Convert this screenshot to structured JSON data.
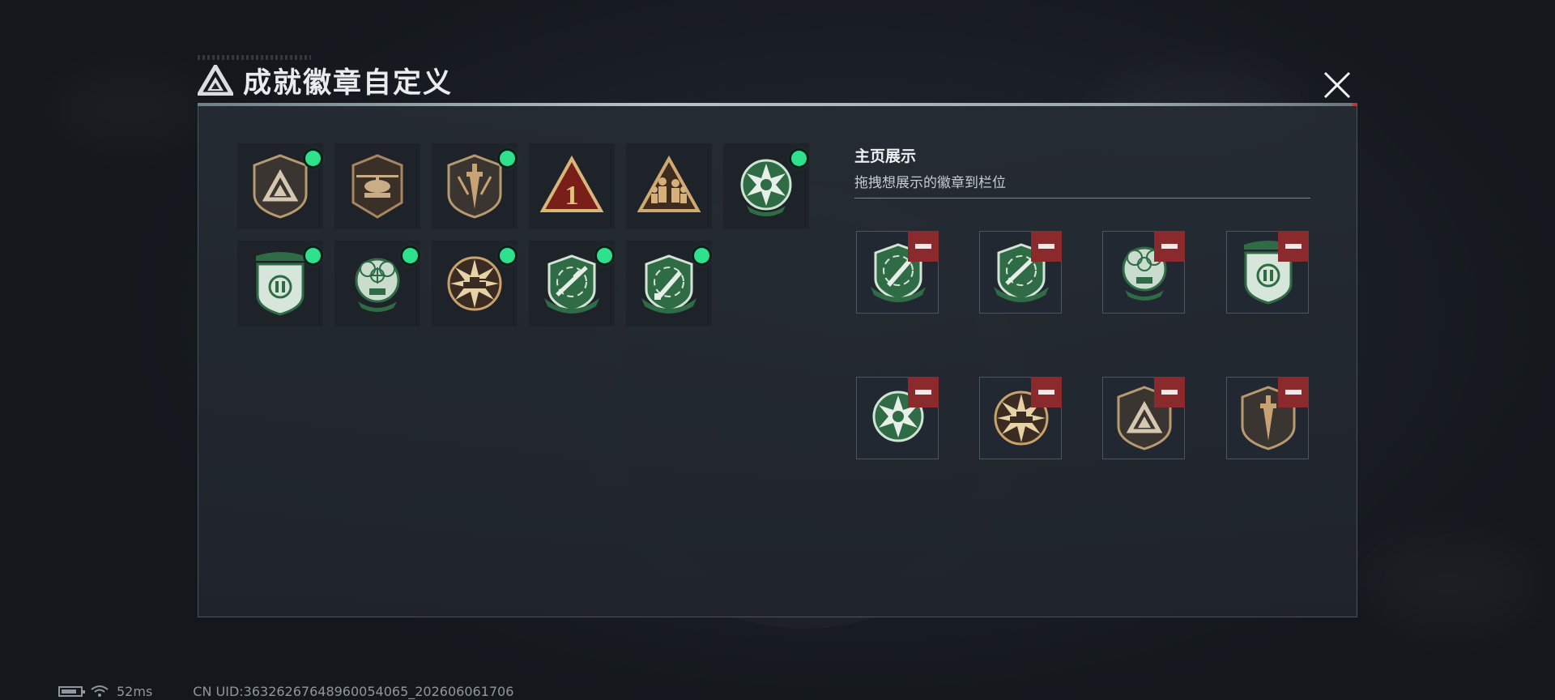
{
  "header": {
    "title": "成就徽章自定义",
    "icon": "triangle-logo-icon",
    "close_icon": "close-icon"
  },
  "badge_collection": [
    {
      "icon": "triangle-shield-badge-icon",
      "new": true
    },
    {
      "icon": "helicopter-badge-icon",
      "new": false
    },
    {
      "icon": "dagger-shield-badge-icon",
      "new": true
    },
    {
      "icon": "number-one-triangle-badge-icon",
      "new": false
    },
    {
      "icon": "soldiers-triangle-badge-icon",
      "new": false
    },
    {
      "icon": "star-skull-green-badge-icon",
      "new": true
    },
    {
      "icon": "pause-shield-green-badge-icon",
      "new": true
    },
    {
      "icon": "skull-crosshair-green-badge-icon",
      "new": true
    },
    {
      "icon": "tank-starburst-badge-icon",
      "new": true
    },
    {
      "icon": "rifle-crosshair-green-badge-icon",
      "new": true
    },
    {
      "icon": "knife-crosshair-green-badge-icon",
      "new": true
    }
  ],
  "showcase": {
    "title": "主页展示",
    "subtitle": "拖拽想展示的徽章到栏位",
    "slots": [
      {
        "icon": "knife-crosshair-green-badge-icon"
      },
      {
        "icon": "rifle-crosshair-green-badge-icon"
      },
      {
        "icon": "skull-crosshair-green-badge-icon"
      },
      {
        "icon": "pause-shield-green-badge-icon"
      },
      {
        "icon": "star-skull-green-badge-icon"
      },
      {
        "icon": "tank-starburst-badge-icon"
      },
      {
        "icon": "triangle-shield-badge-icon"
      },
      {
        "icon": "dagger-shield-badge-icon"
      }
    ],
    "remove_icon": "minus-icon"
  },
  "status_bar": {
    "ping": "52ms",
    "uid": "CN UID:3632626764896005406​5_202606061706"
  },
  "colors": {
    "new_dot": "#2fe08c",
    "remove_bg": "#8a2a2c",
    "green_badge": "#2f6b45",
    "gold_badge": "#c9a36a"
  }
}
